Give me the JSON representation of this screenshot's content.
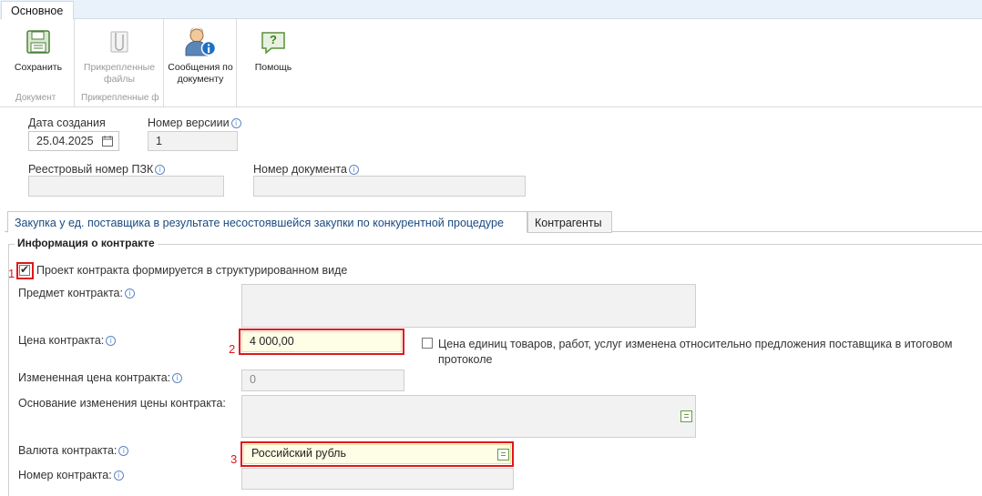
{
  "ribbon": {
    "tab": "Основное",
    "save": "Сохранить",
    "attached_line1": "Прикрепленные",
    "attached_line2": "файлы",
    "messages_line1": "Сообщения по",
    "messages_line2": "документу",
    "help": "Помощь",
    "group_document": "Документ",
    "group_attached": "Прикрепленные ф"
  },
  "header": {
    "creation_date_label": "Дата создания",
    "creation_date_value": "25.04.2025",
    "version_label": "Номер версиии",
    "version_value": "1",
    "registry_label": "Реестровый номер ПЗК",
    "doc_number_label": "Номер документа"
  },
  "tabs": [
    {
      "label": "Закупка у ед. поставщика в результате несостоявшейся закупки по конкурентной процедуре"
    },
    {
      "label": "Контрагенты"
    }
  ],
  "contract": {
    "section_title": "Информация о контракте",
    "structured_checkbox_label": "Проект контракта формируется в структурированном виде",
    "structured_checked": true,
    "subject_label": "Предмет контракта:",
    "price_label": "Цена контракта:",
    "price_value": "4 000,00",
    "unit_price_line1": "Цена единиц товаров, работ, услуг изменена относительно предложения поставщика в итоговом",
    "unit_price_line2": "протоколе",
    "changed_price_label": "Измененная цена контракта:",
    "changed_price_value": "0",
    "change_reason_label": "Основание изменения цены контракта:",
    "currency_label": "Валюта контракта:",
    "currency_value": "Российский рубль",
    "number_label": "Номер контракта:"
  },
  "markers": [
    "1",
    "2",
    "3"
  ],
  "info_glyph": "i",
  "check_glyph": "✔",
  "help_glyph": "?",
  "colors": {
    "accent_red": "#e0161b",
    "tab_blue": "#1a4a80",
    "highlight_yellow": "#fefde6"
  }
}
